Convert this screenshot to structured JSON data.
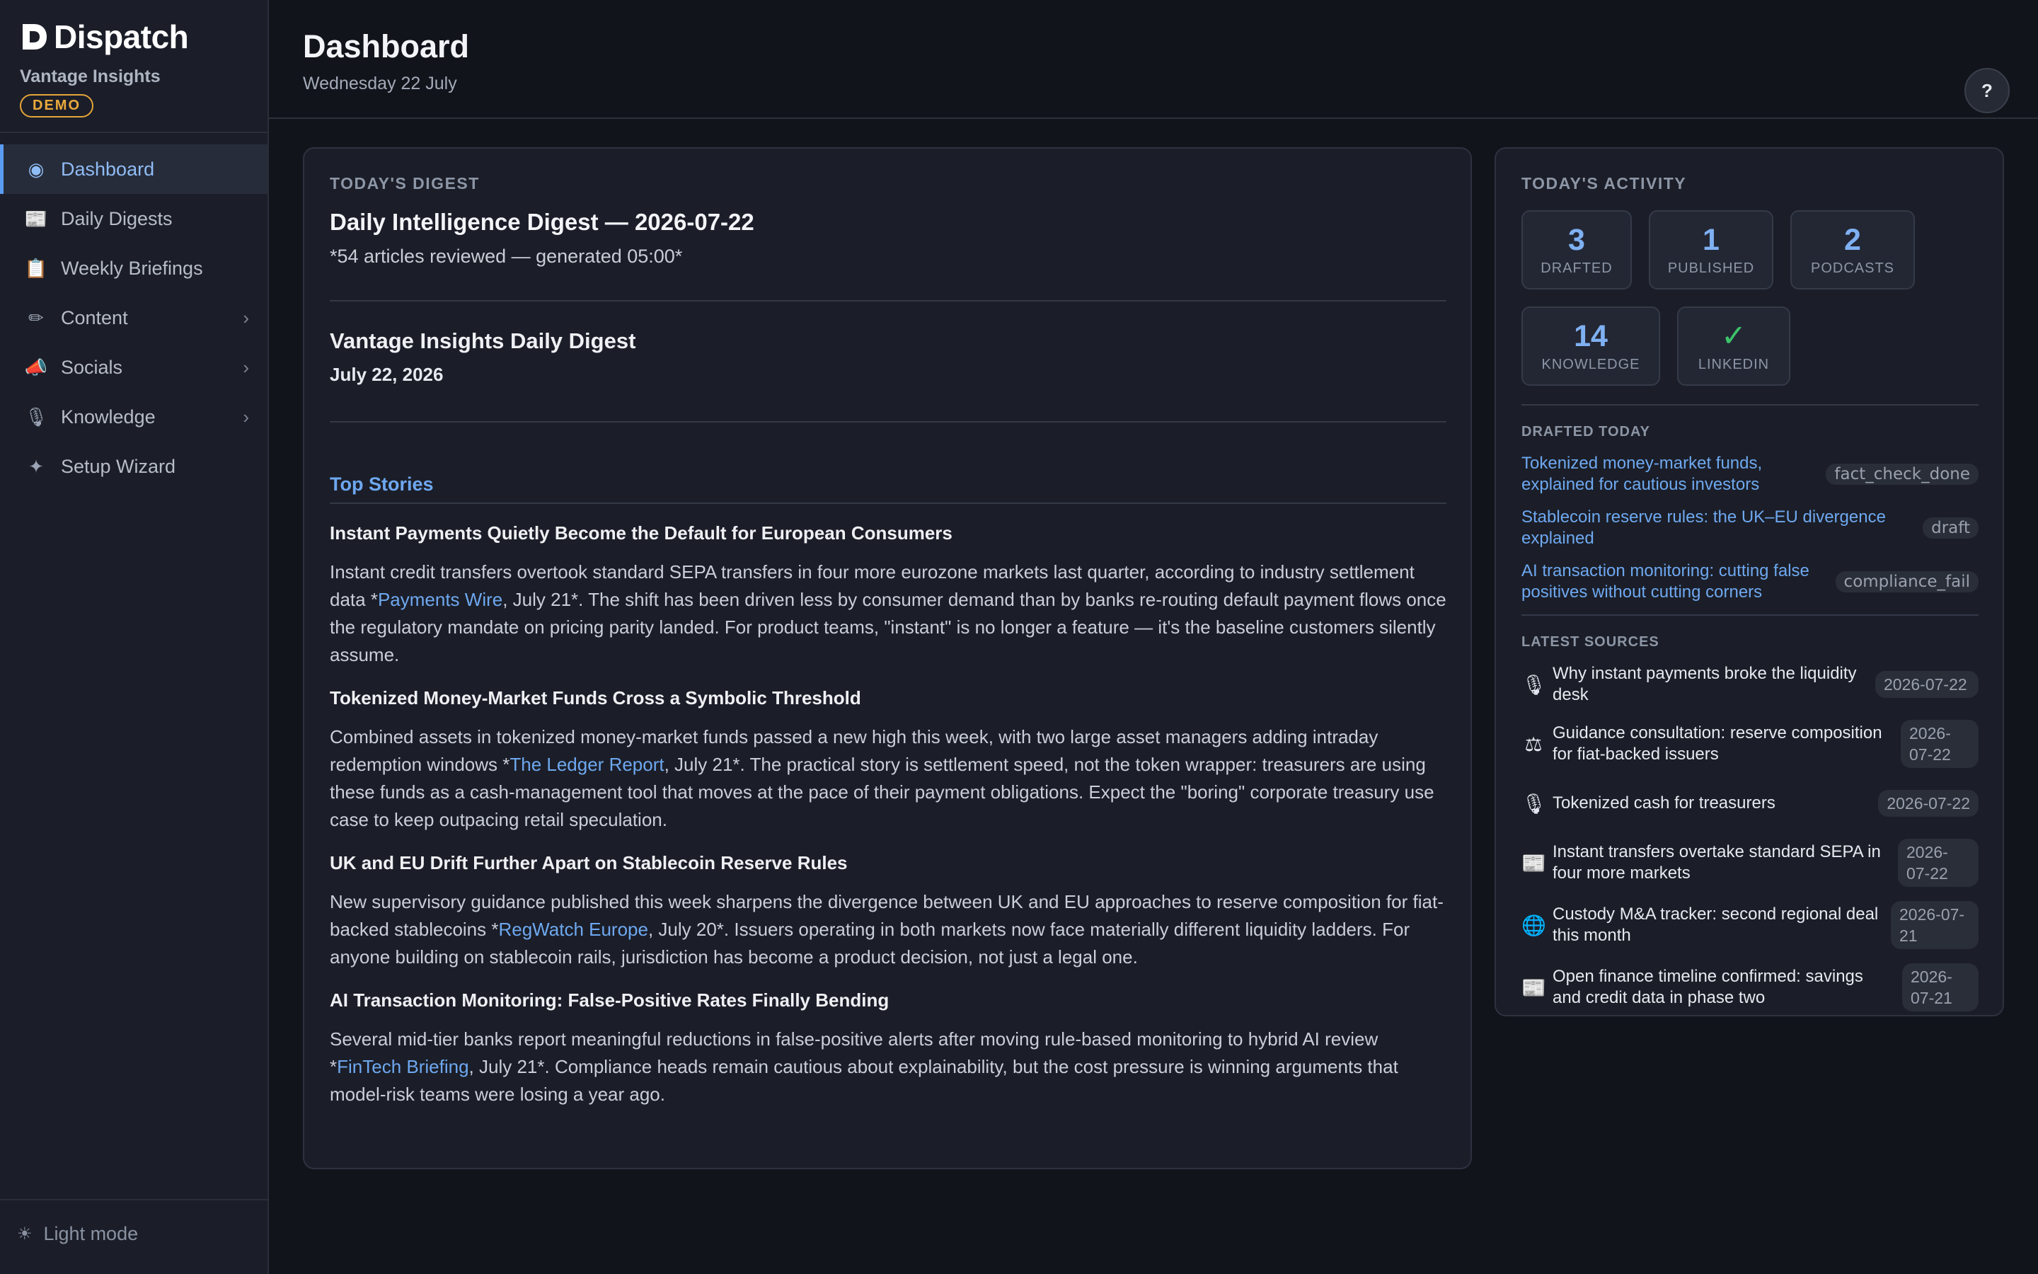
{
  "sidebar": {
    "brand": "Dispatch",
    "org": "Vantage Insights",
    "badge": "DEMO",
    "items": [
      {
        "label": "Dashboard",
        "icon": "◉",
        "active": true
      },
      {
        "label": "Daily Digests",
        "icon": "📰"
      },
      {
        "label": "Weekly Briefings",
        "icon": "📋"
      },
      {
        "label": "Content",
        "icon": "✏",
        "chevron": "›"
      },
      {
        "label": "Socials",
        "icon": "📣",
        "chevron": "›"
      },
      {
        "label": "Knowledge",
        "icon": "🎙",
        "chevron": "›"
      },
      {
        "label": "Setup Wizard",
        "icon": "✦"
      }
    ],
    "light_mode": "Light mode",
    "light_icon": "☀"
  },
  "header": {
    "title": "Dashboard",
    "date": "Wednesday 22 July",
    "help": "?"
  },
  "digest": {
    "label": "TODAY'S DIGEST",
    "title": "Daily Intelligence Digest — 2026-07-22",
    "subtitle": "*54 articles reviewed — generated 05:00*",
    "pub_title": "Vantage Insights Daily Digest",
    "pub_date": "July 22, 2026",
    "section": "Top Stories",
    "stories": [
      {
        "head": "Instant Payments Quietly Become the Default for European Consumers",
        "pre": "Instant credit transfers overtook standard SEPA transfers in four more eurozone markets last quarter, according to industry settlement data *",
        "link": "Payments Wire",
        "post": ", July 21*. The shift has been driven less by consumer demand than by banks re-routing default payment flows once the regulatory mandate on pricing parity landed. For product teams, \"instant\" is no longer a feature — it's the baseline customers silently assume."
      },
      {
        "head": "Tokenized Money-Market Funds Cross a Symbolic Threshold",
        "pre": "Combined assets in tokenized money-market funds passed a new high this week, with two large asset managers adding intraday redemption windows *",
        "link": "The Ledger Report",
        "post": ", July 21*. The practical story is settlement speed, not the token wrapper: treasurers are using these funds as a cash-management tool that moves at the pace of their payment obligations. Expect the \"boring\" corporate treasury use case to keep outpacing retail speculation."
      },
      {
        "head": "UK and EU Drift Further Apart on Stablecoin Reserve Rules",
        "pre": "New supervisory guidance published this week sharpens the divergence between UK and EU approaches to reserve composition for fiat-backed stablecoins *",
        "link": "RegWatch Europe",
        "post": ", July 20*. Issuers operating in both markets now face materially different liquidity ladders. For anyone building on stablecoin rails, jurisdiction has become a product decision, not just a legal one."
      },
      {
        "head": "AI Transaction Monitoring: False-Positive Rates Finally Bending",
        "pre": "Several mid-tier banks report meaningful reductions in false-positive alerts after moving rule-based monitoring to hybrid AI review *",
        "link": "FinTech Briefing",
        "post": ", July 21*. Compliance heads remain cautious about explainability, but the cost pressure is winning arguments that model-risk teams were losing a year ago."
      }
    ]
  },
  "activity": {
    "label": "TODAY'S ACTIVITY",
    "stats": [
      {
        "value": "3",
        "label": "DRAFTED"
      },
      {
        "value": "1",
        "label": "PUBLISHED"
      },
      {
        "value": "2",
        "label": "PODCASTS"
      },
      {
        "value": "14",
        "label": "KNOWLEDGE"
      },
      {
        "value": "✓",
        "label": "LINKEDIN"
      }
    ],
    "drafted_label": "DRAFTED TODAY",
    "drafted": [
      {
        "title": "Tokenized money-market funds, explained for cautious investors",
        "status": "fact_check_done"
      },
      {
        "title": "Stablecoin reserve rules: the UK–EU divergence explained",
        "status": "draft"
      },
      {
        "title": "AI transaction monitoring: cutting false positives without cutting corners",
        "status": "compliance_fail"
      }
    ],
    "sources_label": "LATEST SOURCES",
    "sources": [
      {
        "icon": "🎙",
        "title": "Why instant payments broke the liquidity desk",
        "date": "2026-07-22"
      },
      {
        "icon": "⚖",
        "title": "Guidance consultation: reserve composition for fiat-backed issuers",
        "date": "2026-07-22"
      },
      {
        "icon": "🎙",
        "title": "Tokenized cash for treasurers",
        "date": "2026-07-22"
      },
      {
        "icon": "📰",
        "title": "Instant transfers overtake standard SEPA in four more markets",
        "date": "2026-07-22"
      },
      {
        "icon": "🌐",
        "title": "Custody M&A tracker: second regional deal this month",
        "date": "2026-07-21"
      },
      {
        "icon": "📰",
        "title": "Open finance timeline confirmed: savings and credit data in phase two",
        "date": "2026-07-21"
      }
    ]
  }
}
